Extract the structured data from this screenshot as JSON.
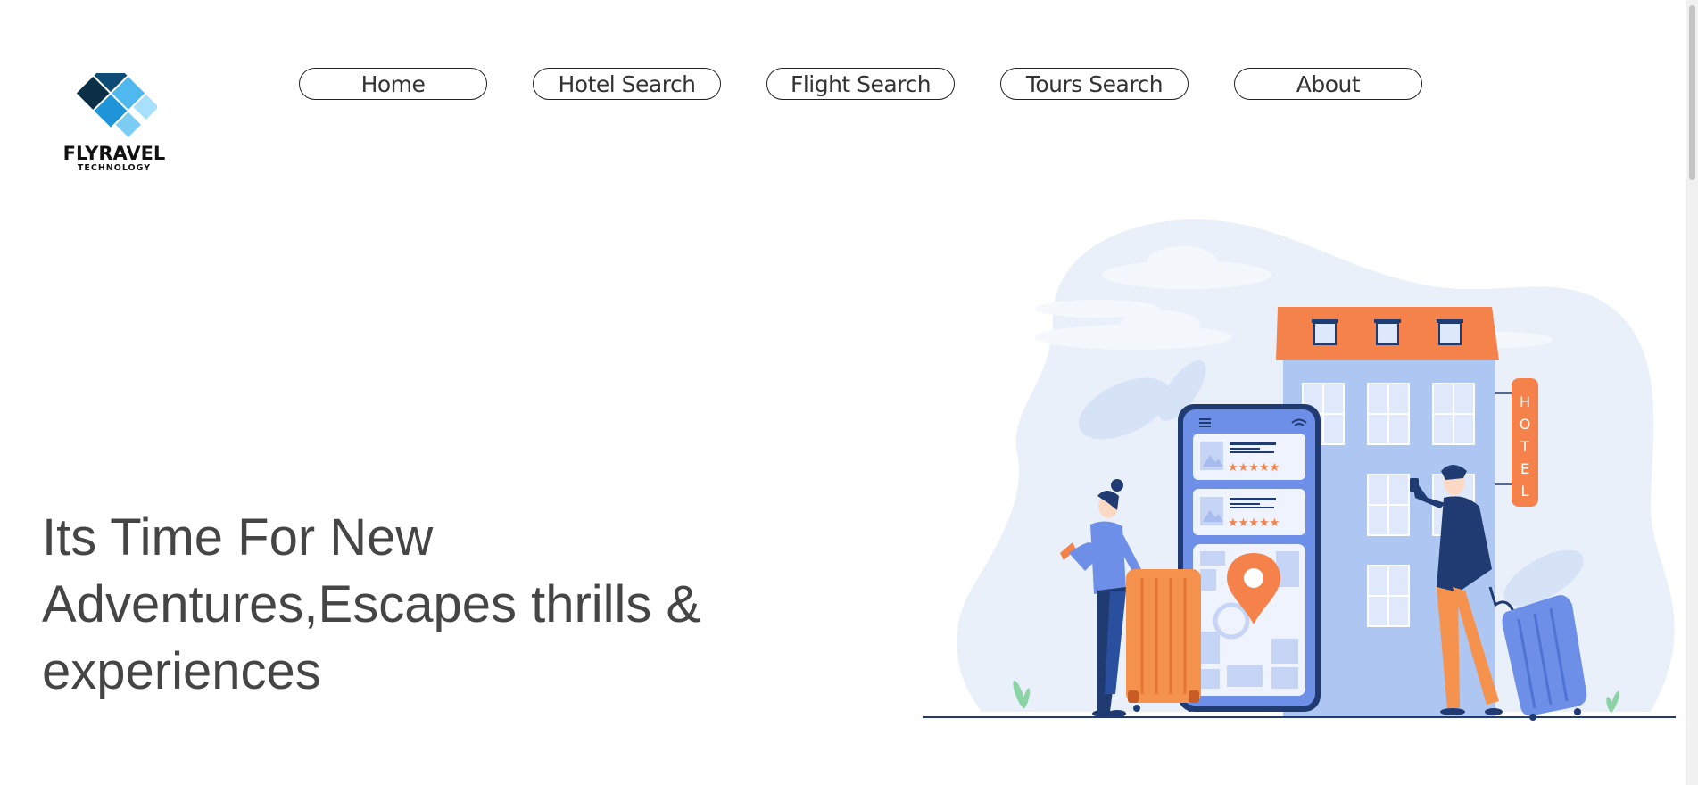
{
  "brand": {
    "name": "FLYRAVEL",
    "tagline": "TECHNOLOGY",
    "colors": [
      "#0b3d5c",
      "#0e7ab8",
      "#2ea6e8",
      "#8fd3f7"
    ]
  },
  "nav": {
    "items": [
      {
        "label": "Home"
      },
      {
        "label": "Hotel Search"
      },
      {
        "label": "Flight Search"
      },
      {
        "label": "Tours Search"
      },
      {
        "label": "About"
      }
    ]
  },
  "hero": {
    "line1": "Its Time For New",
    "line2": "Adventures,Escapes thrills &",
    "line3": "experiences"
  },
  "illustration": {
    "sign_text": "HOTEL",
    "icons": [
      "menu-icon",
      "wifi-icon",
      "image-icon",
      "star-icon",
      "map-pin-icon"
    ],
    "accent_color": "#f5824a",
    "phone_color": "#6d8fe8"
  }
}
